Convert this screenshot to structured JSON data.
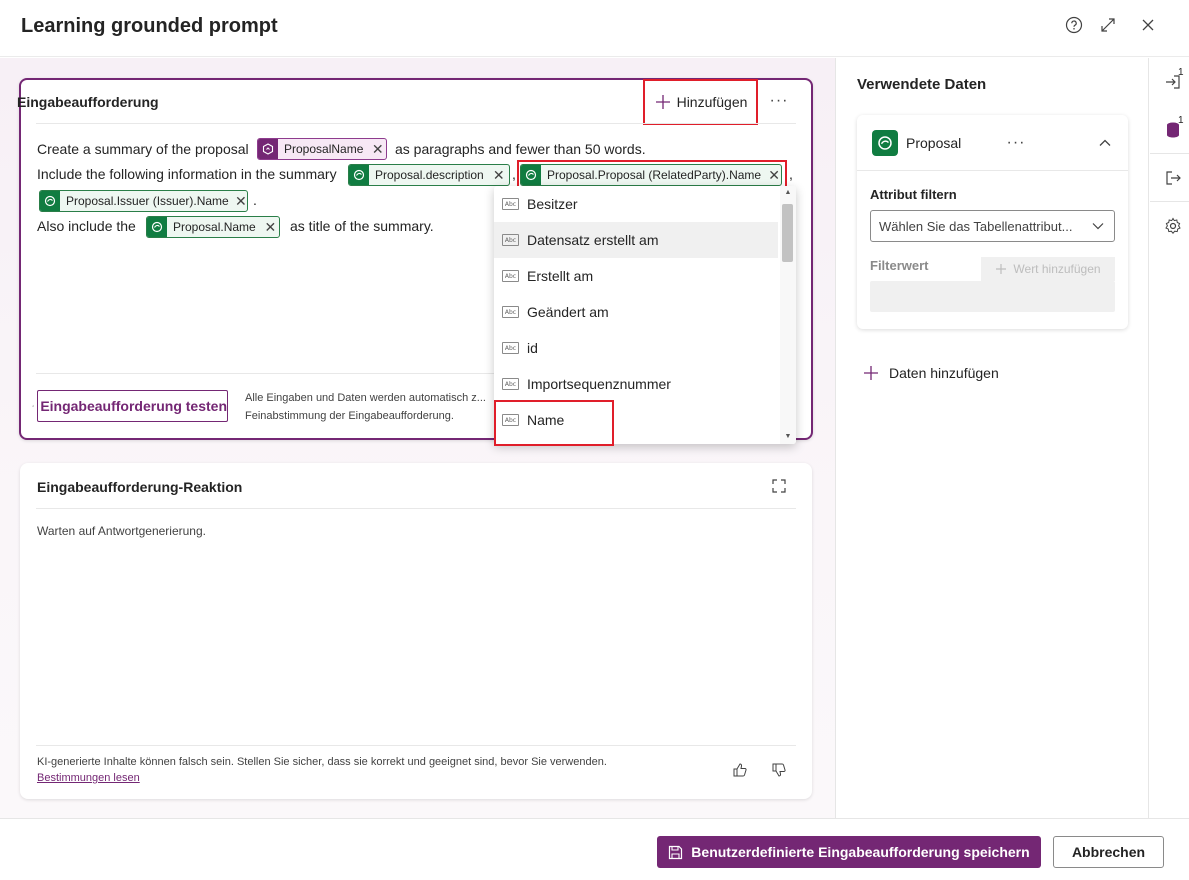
{
  "dialog": {
    "title": "Learning grounded prompt"
  },
  "prompt_card": {
    "title": "Eingabeaufforderung",
    "add_label": "Hinzufügen",
    "line1_before": "Create a summary of the proposal",
    "line1_after": "as paragraphs and fewer than 50 words.",
    "line2_before": "Include the following information in the summary",
    "comma1": ",",
    "comma2": ",",
    "line3_after": ".",
    "line4_before": "Also include the",
    "line4_after": "as title of the summary.",
    "tokens": {
      "proposal_name_var": "ProposalName",
      "description": "Proposal.description",
      "related_party": "Proposal.Proposal (RelatedParty).Name",
      "issuer": "Proposal.Issuer (Issuer).Name",
      "name": "Proposal.Name"
    },
    "test_button": "Eingabeaufforderung testen",
    "test_note": "Alle Eingaben und Daten werden automatisch z... Feinabstimmung der Eingabeaufforderung."
  },
  "attribute_dropdown": {
    "items": [
      "Besitzer",
      "Datensatz erstellt am",
      "Erstellt am",
      "Geändert am",
      "id",
      "Importsequenznummer",
      "Name"
    ],
    "hovered": "Datensatz erstellt am",
    "type_icon": "Abc"
  },
  "response_card": {
    "title": "Eingabeaufforderung-Reaktion",
    "waiting": "Warten auf Antwortgenerierung.",
    "disclaimer": "KI-generierte Inhalte können falsch sein. Stellen Sie sicher, dass sie korrekt und geeignet sind, bevor Sie verwenden.",
    "terms_link": "Bestimmungen lesen"
  },
  "data_panel": {
    "title": "Verwendete Daten",
    "entity": "Proposal",
    "attr_filter_label": "Attribut filtern",
    "attr_select_placeholder": "Wählen Sie das Tabellenattribut...",
    "filter_value_label": "Filterwert",
    "add_value_button": "Wert hinzufügen",
    "add_data_button": "Daten hinzufügen"
  },
  "rail": {
    "input_badge": "1",
    "data_badge": "1"
  },
  "footer": {
    "save_button": "Benutzerdefinierte Eingabeaufforderung speichern",
    "cancel_button": "Abbrechen"
  },
  "colors": {
    "accent": "#742774",
    "dataverse_green": "#107c41",
    "highlight_red": "#e01e2a"
  },
  "icons": [
    "help-icon",
    "expand-icon",
    "close-icon",
    "plus-icon",
    "more-icon",
    "dataverse-icon",
    "variable-icon",
    "flask-icon",
    "fullscreen-icon",
    "thumbs-up-icon",
    "thumbs-down-icon",
    "chevron-up-icon",
    "chevron-down-icon",
    "sign-in-icon",
    "database-icon",
    "sign-out-icon",
    "gear-icon",
    "save-icon"
  ]
}
